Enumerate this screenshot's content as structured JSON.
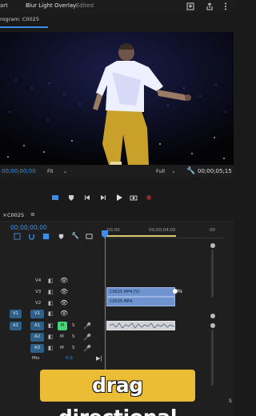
{
  "header": {
    "workspace_fragment": "art",
    "project_title": "Blur Light Overlay",
    "status": "- Edited",
    "icons": [
      "export-icon",
      "share-icon",
      "more-vertical-icon"
    ]
  },
  "program_monitor": {
    "tab_label": "rogram: C0025",
    "timecode_current": "00;00;00;00",
    "fit_select": "Fit",
    "quality_select": "Full",
    "timecode_duration": "00;00;05;15"
  },
  "timeline": {
    "sequence_name": "C0025",
    "timecode": "00;00;00;00",
    "ruler_ticks": [
      ";00;00",
      "00;00;04;00",
      "00"
    ],
    "tracks": [
      {
        "name": "V4",
        "type": "video"
      },
      {
        "name": "V3",
        "type": "video"
      },
      {
        "name": "V2",
        "type": "video"
      },
      {
        "name": "V1",
        "type": "video",
        "source": "V1"
      },
      {
        "name": "A1",
        "type": "audio",
        "source": "A1",
        "m": "M",
        "s": "S"
      },
      {
        "name": "A2",
        "type": "audio",
        "m": "M",
        "s": "S"
      },
      {
        "name": "A3",
        "type": "audio",
        "m": "M",
        "s": "S"
      }
    ],
    "mix_label": "Mix",
    "mix_value": "0.0",
    "clips": [
      {
        "label": "C0025.MP4 [V]",
        "track": "V3"
      },
      {
        "label": "C0025.MP4",
        "track": "V2"
      }
    ],
    "right_letter": "S"
  },
  "caption": {
    "text": "drag directional"
  },
  "colors": {
    "accent_blue": "#3a8ee6",
    "clip_blue": "#6f93cf",
    "mute_green": "#46d67a",
    "caption_bg": "#ebbd35"
  }
}
